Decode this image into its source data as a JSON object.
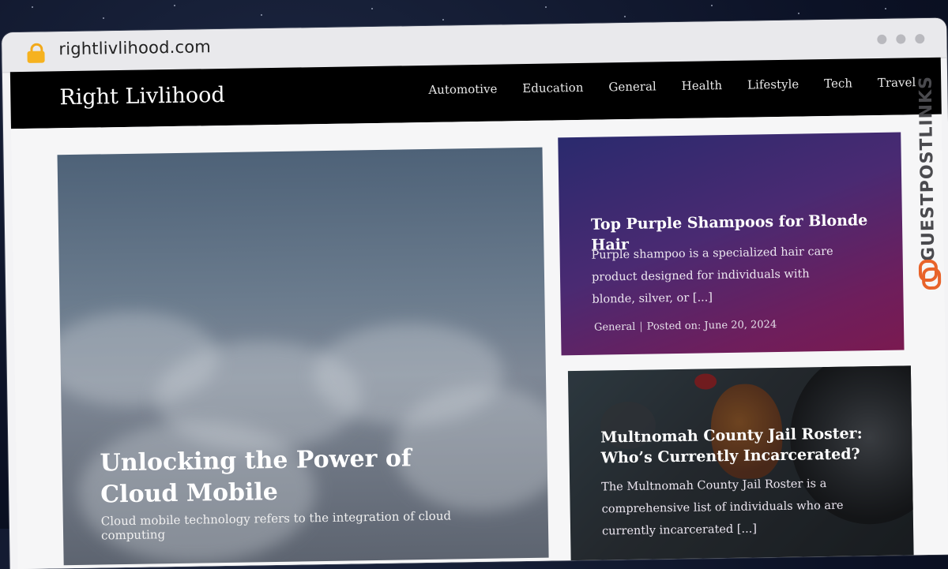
{
  "browser": {
    "url": "rightlivlihood.com"
  },
  "site": {
    "title": "Right Livlihood",
    "nav": [
      "Automotive",
      "Education",
      "General",
      "Health",
      "Lifestyle",
      "Tech",
      "Travel"
    ]
  },
  "hero": {
    "title": "Unlocking the Power of Cloud Mobile",
    "excerpt": "Cloud mobile technology refers to the integration of cloud computing"
  },
  "posts": [
    {
      "title": "Top Purple Shampoos for Blonde Hair",
      "excerpt": "Purple shampoo is a specialized hair care product designed for individuals with blonde, silver, or [...]",
      "category": "General",
      "posted": "Posted on: June 20, 2024"
    },
    {
      "title": "Multnomah County Jail Roster: Who’s Currently Incarcerated?",
      "excerpt": "The Multnomah County Jail Roster is a comprehensive list of individuals who are currently incarcerated [...]"
    }
  ],
  "watermark": {
    "text": "GUESTPOSTLINKS"
  },
  "colors": {
    "header": "#000000",
    "lock": "#f6b21f",
    "card_gradient_start": "#2a2a6e",
    "card_gradient_end": "#7a1a50",
    "brand_accent": "#e8632a"
  }
}
